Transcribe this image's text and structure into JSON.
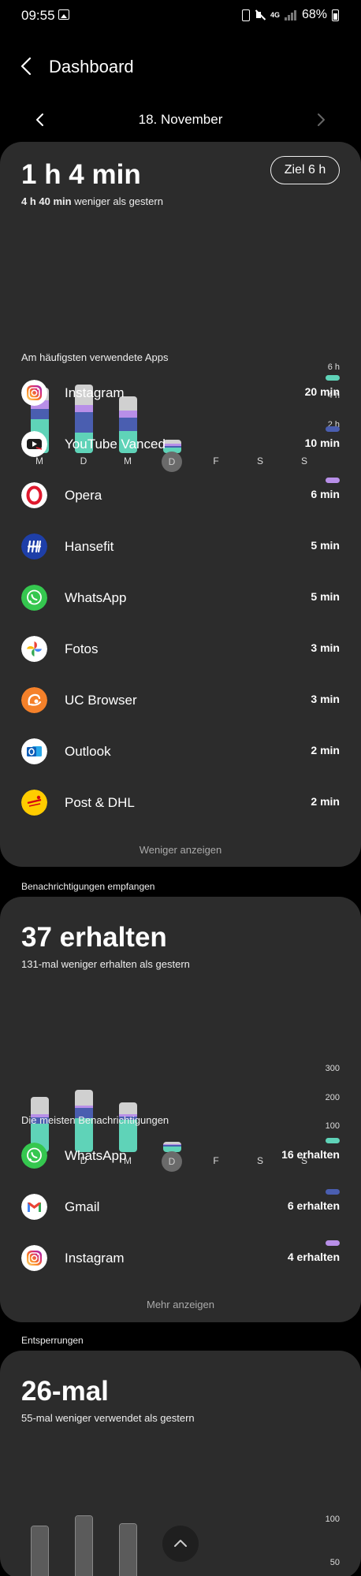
{
  "status_bar": {
    "time": "09:55",
    "network": "4G",
    "battery": "68%"
  },
  "header": {
    "title": "Dashboard"
  },
  "date_nav": {
    "date": "18. November"
  },
  "screen_time": {
    "value": "1 h 4 min",
    "compare_bold": "4 h 40 min",
    "compare_text": "weniger als gestern",
    "goal": "Ziel 6 h",
    "y_ticks": [
      "6 h",
      "4 h",
      "2 h"
    ],
    "apps_label": "Am häufigsten verwendete Apps",
    "apps": [
      {
        "name": "Instagram",
        "value": "20 min",
        "icon": "instagram-icon",
        "legend_color": "#5fd3b8"
      },
      {
        "name": "YouTube Vanced",
        "value": "10 min",
        "icon": "youtube-vanced-icon",
        "legend_color": "#4a5eb0"
      },
      {
        "name": "Opera",
        "value": "6 min",
        "icon": "opera-icon",
        "legend_color": "#b88fe8"
      },
      {
        "name": "Hansefit",
        "value": "5 min",
        "icon": "hansefit-icon"
      },
      {
        "name": "WhatsApp",
        "value": "5 min",
        "icon": "whatsapp-icon"
      },
      {
        "name": "Fotos",
        "value": "3 min",
        "icon": "fotos-icon"
      },
      {
        "name": "UC Browser",
        "value": "3 min",
        "icon": "uc-browser-icon"
      },
      {
        "name": "Outlook",
        "value": "2 min",
        "icon": "outlook-icon"
      },
      {
        "name": "Post & DHL",
        "value": "2 min",
        "icon": "post-dhl-icon"
      }
    ],
    "less_label": "Weniger anzeigen"
  },
  "notifications": {
    "section_label": "Benachrichtigungen empfangen",
    "value": "37 erhalten",
    "compare_text": "131-mal weniger erhalten als gestern",
    "y_ticks": [
      "300",
      "200",
      "100"
    ],
    "apps_label": "Die meisten Benachrichtigungen",
    "apps": [
      {
        "name": "WhatsApp",
        "value": "16 erhalten",
        "icon": "whatsapp-icon",
        "legend_color": "#5fd3b8"
      },
      {
        "name": "Gmail",
        "value": "6 erhalten",
        "icon": "gmail-icon",
        "legend_color": "#4a5eb0"
      },
      {
        "name": "Instagram",
        "value": "4 erhalten",
        "icon": "instagram-icon",
        "legend_color": "#b88fe8"
      }
    ],
    "more_label": "Mehr anzeigen"
  },
  "unlocks": {
    "section_label": "Entsperrungen",
    "value": "26-mal",
    "compare_text": "55-mal weniger verwendet als gestern",
    "y_ticks": [
      "100",
      "50"
    ]
  },
  "days": [
    "M",
    "D",
    "M",
    "D",
    "F",
    "S",
    "S"
  ],
  "colors": {
    "teal": "#5fd3b8",
    "blue": "#4a5eb0",
    "purple": "#b88fe8",
    "gray": "#d0d0d0",
    "card": "#2c2c2c"
  },
  "chart_data": [
    {
      "type": "bar",
      "title": "",
      "categories": [
        "M",
        "D",
        "M",
        "D",
        "F",
        "S",
        "S"
      ],
      "unit": "h",
      "ylim": [
        0,
        6.2
      ],
      "series": [
        {
          "name": "Instagram",
          "color": "#5fd3b8",
          "values": [
            2.3,
            1.4,
            1.5,
            0.35,
            0,
            0,
            0
          ]
        },
        {
          "name": "YouTube Vanced",
          "color": "#4a5eb0",
          "values": [
            0.7,
            1.4,
            0.9,
            0.15,
            0,
            0,
            0
          ]
        },
        {
          "name": "Opera",
          "color": "#b88fe8",
          "values": [
            0.6,
            0.5,
            0.5,
            0.12,
            0,
            0,
            0
          ]
        },
        {
          "color": "#d0d0d0",
          "values": [
            0.9,
            1.4,
            1.0,
            0.3,
            0,
            0,
            0
          ]
        }
      ]
    },
    {
      "type": "bar",
      "title": "",
      "categories": [
        "M",
        "D",
        "M",
        "D",
        "F",
        "S",
        "S"
      ],
      "unit": "",
      "ylim": [
        0,
        310
      ],
      "series": [
        {
          "name": "WhatsApp",
          "color": "#5fd3b8",
          "values": [
            100,
            120,
            115,
            20,
            0,
            0,
            0
          ]
        },
        {
          "name": "Gmail",
          "color": "#4a5eb0",
          "values": [
            22,
            35,
            12,
            5,
            0,
            0,
            0
          ]
        },
        {
          "name": "Instagram",
          "color": "#b88fe8",
          "values": [
            13,
            10,
            8,
            4,
            0,
            0,
            0
          ]
        },
        {
          "color": "#d0d0d0",
          "values": [
            60,
            55,
            40,
            8,
            0,
            0,
            0
          ]
        }
      ]
    },
    {
      "type": "bar",
      "title": "",
      "categories": [
        "M",
        "D",
        "M",
        "D",
        "F",
        "S",
        "S"
      ],
      "unit": "",
      "ylim": [
        0,
        125
      ],
      "series": [
        {
          "color": "#5b5b5b",
          "values": [
            78,
            88,
            80,
            26,
            0,
            0,
            0
          ]
        }
      ]
    }
  ]
}
